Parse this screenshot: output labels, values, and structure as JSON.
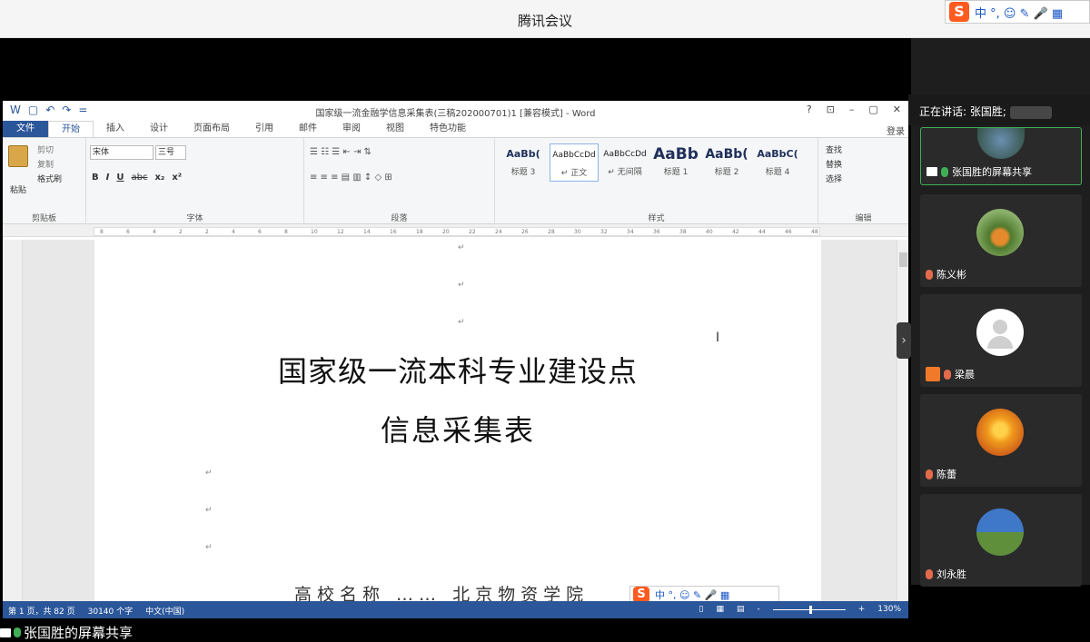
{
  "app": {
    "title": "腾讯会议"
  },
  "ime": {
    "logo": "S",
    "items": "中 °, ☺ ✎ 🎤 ▦"
  },
  "word": {
    "doc_title": "国家级一流金融学信息采集表(三稿202000701)1 [兼容模式] - Word",
    "quick_access": [
      "W",
      "▢",
      "↶",
      "↷",
      "="
    ],
    "window_controls": [
      "?",
      "⊡",
      "–",
      "▢",
      "✕"
    ],
    "tabs": [
      "文件",
      "开始",
      "插入",
      "设计",
      "页面布局",
      "引用",
      "邮件",
      "审阅",
      "视图",
      "特色功能"
    ],
    "active_tab": "开始",
    "login": "登录",
    "ribbon": {
      "clipboard": {
        "paste": "粘贴",
        "cut": "剪切",
        "copy": "复制",
        "format_painter": "格式刷",
        "label": "剪贴板"
      },
      "font": {
        "name": "宋体",
        "size": "三号",
        "label": "字体",
        "bold": "B",
        "italic": "I",
        "underline": "U",
        "strike": "abc",
        "sub": "x₂",
        "sup": "x²"
      },
      "paragraph": {
        "label": "段落"
      },
      "styles": {
        "label": "样式",
        "items": [
          {
            "preview": "AaBb(",
            "name": "标题 3"
          },
          {
            "preview": "AaBbCcDd",
            "name": "↵ 正文"
          },
          {
            "preview": "AaBbCcDd",
            "name": "↵ 无间隔"
          },
          {
            "preview": "AaBb",
            "name": "标题 1"
          },
          {
            "preview": "AaBb(",
            "name": "标题 2"
          },
          {
            "preview": "AaBbC(",
            "name": "标题 4"
          }
        ]
      },
      "editing": {
        "find": "查找",
        "replace": "替换",
        "select": "选择",
        "label": "编辑"
      }
    },
    "ruler_ticks": [
      "8",
      "6",
      "4",
      "2",
      "2",
      "4",
      "6",
      "8",
      "10",
      "12",
      "14",
      "16",
      "18",
      "20",
      "22",
      "24",
      "26",
      "28",
      "30",
      "32",
      "34",
      "36",
      "38",
      "40",
      "42",
      "44",
      "46",
      "48"
    ],
    "document": {
      "heading1": "国家级一流本科专业建设点",
      "heading2": "信息采集表",
      "bottom_line": "高校名称 …… 北京物资学院"
    },
    "status": {
      "page": "第 1 页，共 82 页",
      "words": "30140 个字",
      "lang": "中文(中国)",
      "zoom": "130%"
    }
  },
  "panel": {
    "speaking_label": "正在讲话: 张国胜;",
    "participants": [
      {
        "name": "张国胜的屏幕共享",
        "type": "share"
      },
      {
        "name": "陈义彬",
        "type": "muted"
      },
      {
        "name": "梁晨",
        "type": "muted-user"
      },
      {
        "name": "陈蕾",
        "type": "muted"
      },
      {
        "name": "刘永胜",
        "type": "muted"
      }
    ]
  },
  "caption": "张国胜的屏幕共享"
}
